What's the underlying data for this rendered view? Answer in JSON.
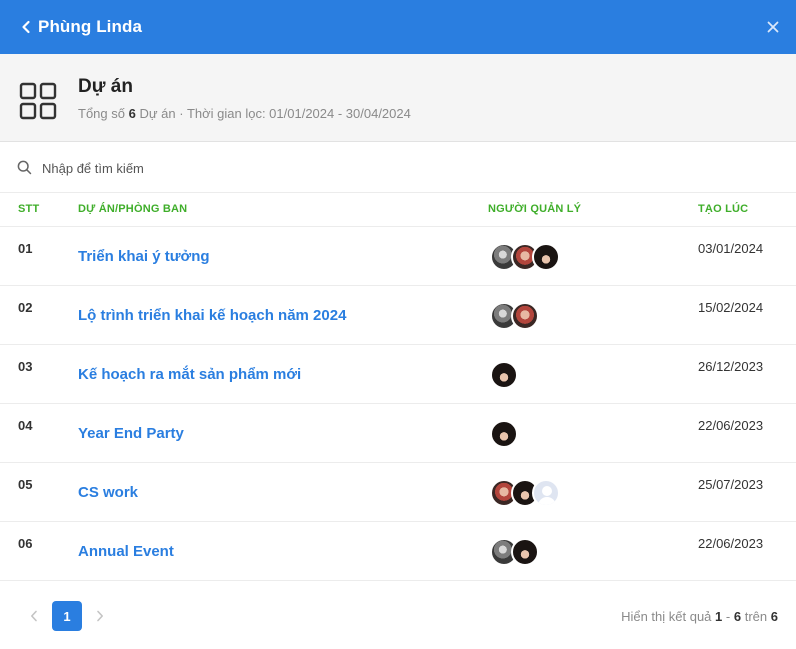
{
  "header": {
    "title": "Phùng Linda",
    "back_icon": "chevron-left-icon",
    "close_icon": "close-icon"
  },
  "summary": {
    "icon": "grid-icon",
    "title": "Dự án",
    "total_prefix": "Tổng số",
    "total_count": "6",
    "total_suffix": "Dự án · Thời gian lọc: 01/01/2024 - 30/04/2024"
  },
  "search": {
    "placeholder": "Nhập để tìm kiếm",
    "value": ""
  },
  "table": {
    "columns": {
      "stt": "STT",
      "project": "DỰ ÁN/PHÒNG BAN",
      "manager": "NGƯỜI QUẢN LÝ",
      "created": "TẠO LÚC"
    },
    "rows": [
      {
        "stt": "01",
        "name": "Triển khai ý tưởng",
        "managers": [
          "a1",
          "a2",
          "a3"
        ],
        "created": "03/01/2024"
      },
      {
        "stt": "02",
        "name": "Lộ trình triển khai kế hoạch năm 2024",
        "managers": [
          "a1",
          "a2"
        ],
        "created": "15/02/2024"
      },
      {
        "stt": "03",
        "name": "Kế hoạch ra mắt sản phẩm mới",
        "managers": [
          "a3"
        ],
        "created": "26/12/2023"
      },
      {
        "stt": "04",
        "name": "Year End Party",
        "managers": [
          "a3"
        ],
        "created": "22/06/2023"
      },
      {
        "stt": "05",
        "name": "CS work",
        "managers": [
          "a2",
          "a3",
          "a4"
        ],
        "created": "25/07/2023"
      },
      {
        "stt": "06",
        "name": "Annual Event",
        "managers": [
          "a1",
          "a3"
        ],
        "created": "22/06/2023"
      }
    ]
  },
  "pagination": {
    "current_page": "1",
    "result_prefix": "Hiển thị kết quả",
    "from": "1",
    "sep": "-",
    "to": "6",
    "of_label": "trên",
    "total": "6"
  },
  "colors": {
    "primary": "#2a7ee0",
    "column_header": "#3fae2a",
    "summary_bg": "#f5f5f5"
  }
}
